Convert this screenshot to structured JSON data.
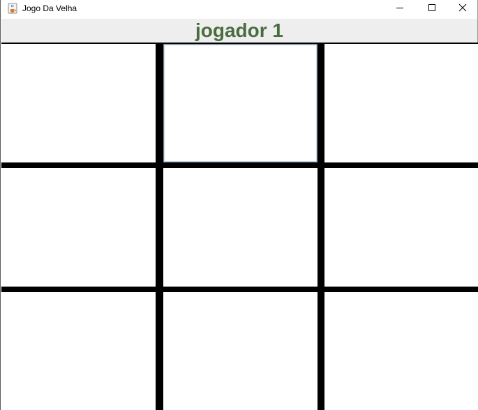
{
  "window": {
    "title": "Jogo Da Velha",
    "icon": "java-coffee-icon",
    "controls": {
      "minimize_icon": "minimize-icon",
      "maximize_icon": "maximize-icon",
      "close_icon": "close-icon"
    }
  },
  "status": {
    "turn_label": "jogador 1",
    "color": "#4a6d3f"
  },
  "board": {
    "rows": 3,
    "cols": 3,
    "cells": [
      "",
      "",
      "",
      "",
      "",
      "",
      "",
      "",
      ""
    ],
    "focused_index": 1,
    "line_color": "#000000",
    "cell_color": "#ffffff"
  }
}
